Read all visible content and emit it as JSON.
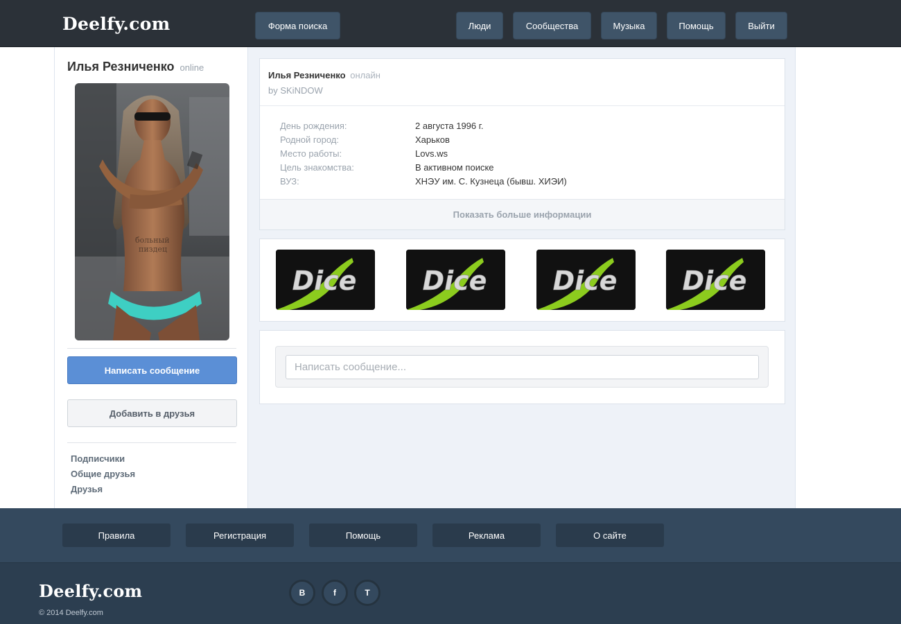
{
  "header": {
    "logo": "Deelfy.com",
    "search_form": "Форма поиска",
    "nav": {
      "people": "Люди",
      "communities": "Сообщества",
      "music": "Музыка",
      "help": "Помощь",
      "logout": "Выйти"
    }
  },
  "sidebar": {
    "name": "Илья Резниченко",
    "status": "online",
    "write_message": "Написать сообщение",
    "add_friend": "Добавить в друзья",
    "links": [
      "Подписчики",
      "Общие друзья",
      "Друзья"
    ]
  },
  "profile": {
    "name": "Илья Резниченко",
    "status": "онлайн",
    "by": "by SKiNDOW",
    "fields": [
      {
        "label": "День рождения:",
        "value": "2 августа 1996 г."
      },
      {
        "label": "Родной город:",
        "value": "Харьков"
      },
      {
        "label": "Место работы:",
        "value": "Lovs.ws"
      },
      {
        "label": "Цель знакомства:",
        "value": "В активном поиске"
      },
      {
        "label": "ВУЗ:",
        "value": "ХНЭУ им. С. Кузнеца (бывш. ХИЭИ)"
      }
    ],
    "show_more": "Показать больше информации"
  },
  "media": {
    "tiles": [
      "Dice",
      "Dice",
      "Dice",
      "Dice"
    ]
  },
  "message": {
    "placeholder": "Написать сообщение..."
  },
  "footer": {
    "links": [
      "Правила",
      "Регистрация",
      "Помощь",
      "Реклама",
      "О сайте"
    ],
    "logo": "Deelfy.com",
    "copyright": "© 2014 Deelfy.com",
    "social": [
      "В",
      "f",
      "T"
    ]
  },
  "colors": {
    "header_bg": "#2b3138",
    "nav_button": "#3f5468",
    "accent_blue": "#5b8fd6",
    "main_bg": "#eef2f8",
    "footer_links_bg": "#34495e",
    "footer_bottom_bg": "#2c3e50",
    "dice_green": "#8ccc1e"
  }
}
